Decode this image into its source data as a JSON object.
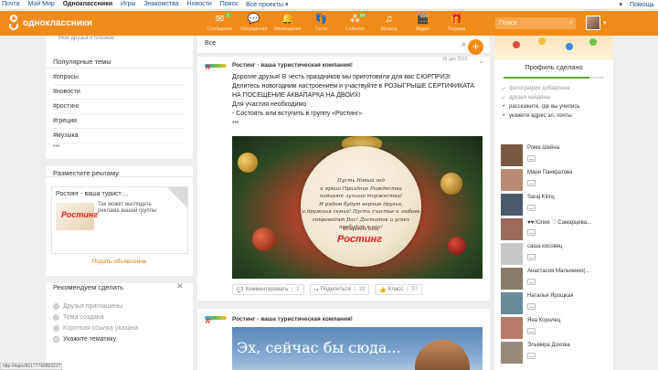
{
  "topbar": {
    "links": [
      "Почта",
      "Мой Мир",
      "Одноклассники",
      "Игры",
      "Знакомства",
      "Новости",
      "Поиск",
      "Все проекты ▾"
    ],
    "user_dropdown": "▾",
    "help": "Помощь"
  },
  "header": {
    "logo_text": "одноклассники",
    "nav": [
      {
        "label": "Сообщения",
        "icon": "envelope-icon",
        "glyph": "✉",
        "badge": "1"
      },
      {
        "label": "Обсуждения",
        "icon": "chat-icon",
        "glyph": "💬",
        "badge": ""
      },
      {
        "label": "Оповещения",
        "icon": "bell-icon",
        "glyph": "🔔",
        "badge": ""
      },
      {
        "label": "Гости",
        "icon": "footprints-icon",
        "glyph": "👣",
        "badge": ""
      },
      {
        "label": "События",
        "icon": "events-icon",
        "glyph": "⁂",
        "badge": "55"
      },
      {
        "label": "Музыка",
        "icon": "music-icon",
        "glyph": "♫",
        "badge": ""
      },
      {
        "label": "Видео",
        "icon": "video-icon",
        "glyph": "🎬",
        "badge": ""
      },
      {
        "label": "Подарки",
        "icon": "gift-icon",
        "glyph": "🎁",
        "badge": ""
      }
    ],
    "search_placeholder": "Поиск"
  },
  "left": {
    "cut_text": "Мои друзья и близкие",
    "popular_title": "Популярные темы",
    "topics": [
      "#опросы",
      "#новости",
      "#ростинг",
      "#греция",
      "#музыка"
    ],
    "more": "•••",
    "ad_section_title": "Разместите рекламу",
    "ad_title": "Ростинг - ваша турист ...",
    "ad_text": "Так может выглядеть реклама вашей группы",
    "ad_logo": "Ростинг",
    "ad_link": "Подать объявление",
    "recs_title": "Рекомендуем сделать",
    "recs": [
      {
        "label": "Друзья приглашены",
        "done": true
      },
      {
        "label": "Тема создана",
        "done": true
      },
      {
        "label": "Короткая ссылка указана",
        "done": true
      },
      {
        "label": "Укажите тематику",
        "done": false
      }
    ]
  },
  "feed": {
    "tab": "Все",
    "post": {
      "author": "Ростинг - ваша туристическая компания!",
      "date": "28 дек 2016",
      "lines": [
        "Дорогие друзья! В честь праздников  мы приготовили для вас СЮРПРИЗ!",
        "Делитесь новогодним настроением и участвуйте в РОЗЫГРЫШЕ  СЕРТИФИКАТА",
        "НА ПОСЕЩЕНИЕ АКВАПАРКА НА ДВОИХ!",
        "Для участия необходимо",
        "- Состоять или вступить в группу «Ростинг»"
      ],
      "more": "•••",
      "image": {
        "verse": [
          "Пусть Новый год",
          "и яркий Праздник Рождества",
          "подарят лучшие торжества!",
          "И рядом будут верные друзья,",
          "и дружная семья! Пусть счастье и любовь",
          "сопроводят Вас! Достаток и успех",
          "пребудут в них!"
        ],
        "signature": "Искренне Ваш",
        "brand": "Ростинг"
      },
      "actions": [
        {
          "label": "Комментировать",
          "count": "1",
          "icon": "comment-icon",
          "glyph": "💬"
        },
        {
          "label": "Поделиться",
          "count": "33",
          "icon": "share-icon",
          "glyph": "↪"
        },
        {
          "label": "Класс",
          "count": "37",
          "icon": "like-icon",
          "glyph": "👍"
        }
      ]
    },
    "post2": {
      "author": "Ростинг - ваша туристическая компания!",
      "caption": "Эх, сейчас бы сюда..."
    }
  },
  "right": {
    "done_title": "Профиль сделано",
    "progress": 0.85,
    "checklist": [
      {
        "label": "фотография добавлена",
        "done": true
      },
      {
        "label": "друзья найдены",
        "done": true
      },
      {
        "label": "расскажите, где вы учились",
        "done": false
      },
      {
        "label": "укажите адрес эл. почты",
        "done": false
      }
    ],
    "friends": [
      {
        "name": "Рома Шейна",
        "color": "#7a5a44"
      },
      {
        "name": "Мари Панкратова",
        "color": "#b98a74"
      },
      {
        "name": "Saraj Kilinç",
        "color": "#4a5a6a"
      },
      {
        "name": "♥♥ Юлия ♡ Самарцева...",
        "color": "#9a6a5a"
      },
      {
        "name": "саша косовец",
        "color": "#c8c8c8"
      },
      {
        "name": "Анастасия Мальченко(...",
        "color": "#8a7a6a"
      },
      {
        "name": "Наталья Ярощкая",
        "color": "#6a8a9a"
      },
      {
        "name": "Яна Королец",
        "color": "#b87a6a"
      },
      {
        "name": "Эльмира Дохова",
        "color": "#9a8a7a"
      }
    ]
  },
  "status_url": "http://topic/66177749893227"
}
